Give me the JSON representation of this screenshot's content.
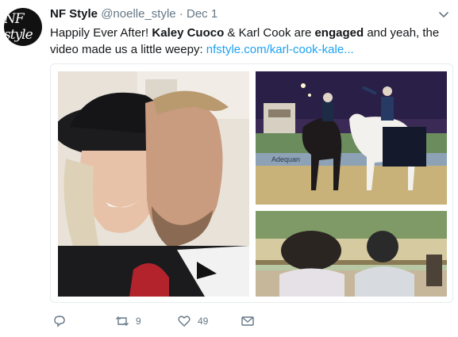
{
  "tweet": {
    "avatar_text": "NF style",
    "display_name": "NF Style",
    "handle": "@noelle_style",
    "separator": "·",
    "date": "Dec 1",
    "text": {
      "part1": "Happily Ever After! ",
      "bold1": "Kaley Cuoco",
      "part2": " & Karl Cook are ",
      "bold2": "engaged",
      "part3": " and yeah, the video made us a little weepy: ",
      "link": "nfstyle.com/karl-cook-kale..."
    },
    "media": {
      "photo1": "couple-kiss-photo",
      "photo2": "horses-riders-night-photo",
      "photo3": "riders-watching-arena-photo",
      "arena_sign": "Adequan"
    },
    "actions": {
      "reply_count": "",
      "retweet_count": "9",
      "like_count": "49"
    },
    "colors": {
      "link": "#1da1f2",
      "muted": "#657786"
    }
  }
}
